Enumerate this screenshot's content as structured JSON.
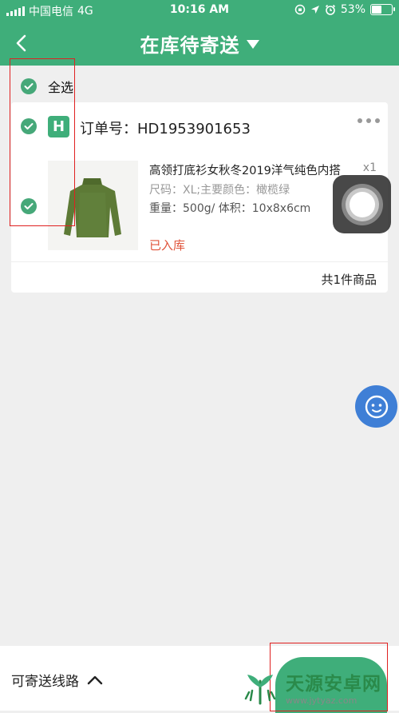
{
  "status_bar": {
    "carrier": "中国电信",
    "network": "4G",
    "time": "10:16 AM",
    "battery": "53%",
    "battery_level": 0.53
  },
  "header": {
    "title": "在库待寄送",
    "back_icon": "chevron-left-icon",
    "dropdown_icon": "triangle-down-icon"
  },
  "select_all": {
    "label": "全选"
  },
  "order": {
    "order_no_label": "订单号：",
    "order_no": "HD1953901653",
    "shop_logo": "H",
    "item": {
      "title": "高领打底衫女秋冬2019洋气纯色内搭",
      "qty": "x1",
      "spec": "尺码：XL;主要颜色：橄榄绿",
      "weight": "重量：500g/ 体积：10x8x6cm",
      "status": "已入库"
    },
    "total": "共1件商品"
  },
  "bottom_bar": {
    "routes_label": "可寄送线路"
  },
  "watermark": {
    "name": "天源安卓网",
    "url": "www.jytyaz.com"
  },
  "colors": {
    "brand_green": "#3fae7a",
    "check_green": "#46a879",
    "status_red": "#e0533a",
    "annotation_red": "#e02020"
  }
}
